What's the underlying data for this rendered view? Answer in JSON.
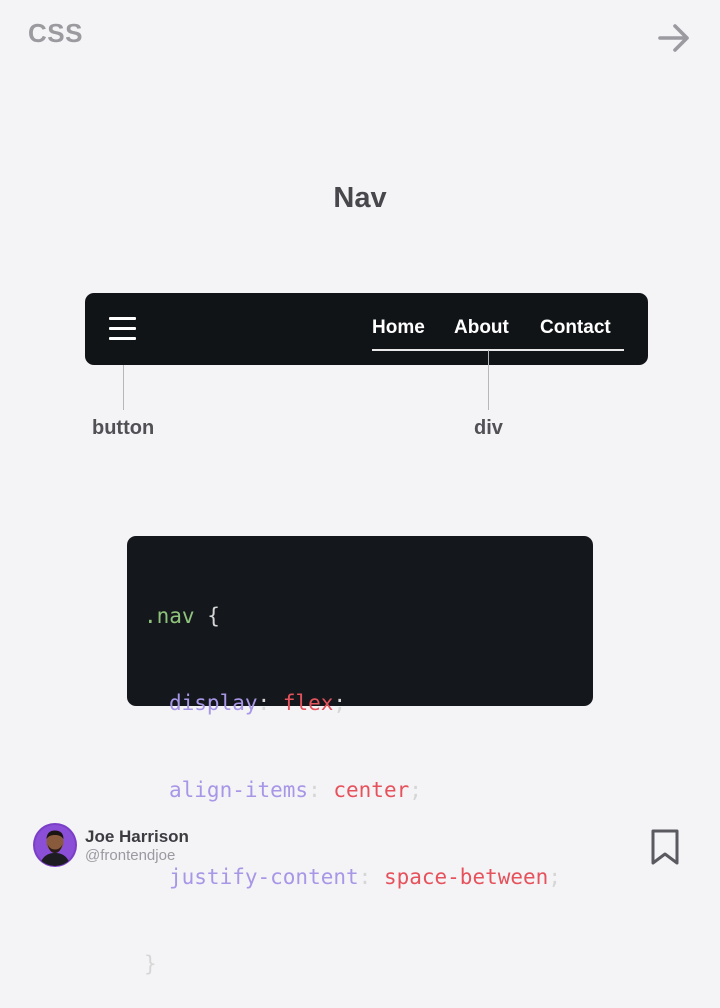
{
  "header": {
    "tag": "CSS",
    "next_icon": "arrow-right-icon"
  },
  "title": "Nav",
  "nav_demo": {
    "menu_icon": "hamburger-menu-icon",
    "links": [
      "Home",
      "About",
      "Contact"
    ],
    "background": "#111417"
  },
  "annotations": {
    "button": "button",
    "div": "div"
  },
  "code": {
    "selector": ".nav",
    "open_brace": "{",
    "close_brace": "}",
    "declarations": [
      {
        "property": "display",
        "value": "flex"
      },
      {
        "property": "align-items",
        "value": "center"
      },
      {
        "property": "justify-content",
        "value": "space-between"
      }
    ],
    "colors": {
      "selector": "#8fc27a",
      "property": "#a896e6",
      "value": "#e6525c"
    }
  },
  "footer": {
    "author_name": "Joe Harrison",
    "author_handle": "@frontendjoe",
    "avatar_icon": "avatar",
    "bookmark_icon": "bookmark-icon"
  }
}
